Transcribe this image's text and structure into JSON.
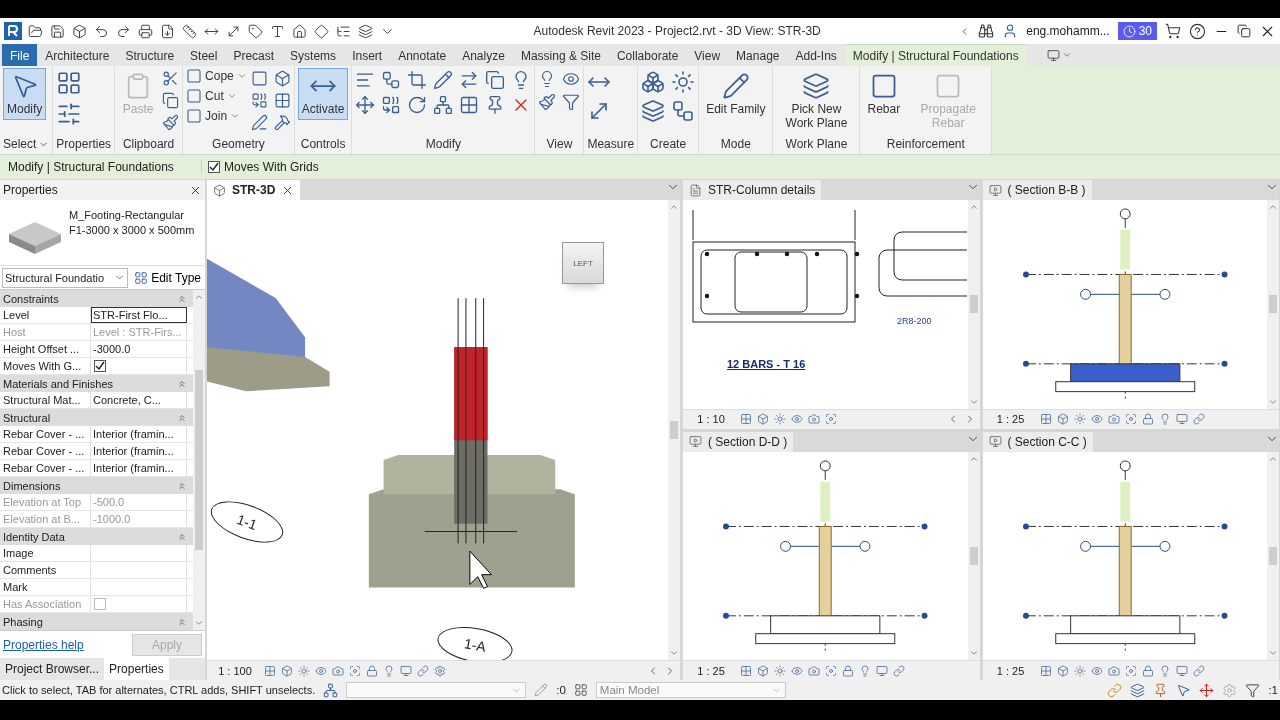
{
  "title_bar": {
    "title": "Autodesk Revit 2023 - Project2.rvt - 3D View: STR-3D",
    "user": "eng.mohamm...",
    "trial_days": "30"
  },
  "ribbon_tabs": [
    {
      "label": "File",
      "kind": "file",
      "selected": false
    },
    {
      "label": "Architecture",
      "kind": "tab",
      "selected": false
    },
    {
      "label": "Structure",
      "kind": "tab",
      "selected": false
    },
    {
      "label": "Steel",
      "kind": "tab",
      "selected": false
    },
    {
      "label": "Precast",
      "kind": "tab",
      "selected": false
    },
    {
      "label": "Systems",
      "kind": "tab",
      "selected": false
    },
    {
      "label": "Insert",
      "kind": "tab",
      "selected": false
    },
    {
      "label": "Annotate",
      "kind": "tab",
      "selected": false
    },
    {
      "label": "Analyze",
      "kind": "tab",
      "selected": false
    },
    {
      "label": "Massing & Site",
      "kind": "tab",
      "selected": false
    },
    {
      "label": "Collaborate",
      "kind": "tab",
      "selected": false
    },
    {
      "label": "View",
      "kind": "tab",
      "selected": false
    },
    {
      "label": "Manage",
      "kind": "tab",
      "selected": false
    },
    {
      "label": "Add-Ins",
      "kind": "tab",
      "selected": false
    },
    {
      "label": "Modify | Structural Foundations",
      "kind": "tab",
      "selected": true
    }
  ],
  "ribbon": {
    "panels": [
      {
        "label": "Select",
        "menu": true,
        "tools": [
          {
            "kind": "large",
            "label": "Modify",
            "selected": true,
            "disabled": false
          }
        ]
      },
      {
        "label": "Properties",
        "menu": false
      },
      {
        "label": "Clipboard",
        "menu": false,
        "tools": [
          {
            "kind": "large",
            "label": "Paste",
            "selected": false,
            "disabled": true
          }
        ]
      },
      {
        "label": "Geometry",
        "menu": false,
        "tools": [
          {
            "kind": "small",
            "label": "Cope",
            "menu": true
          },
          {
            "kind": "small",
            "label": "Cut",
            "menu": true
          },
          {
            "kind": "small",
            "label": "Join",
            "menu": true
          }
        ]
      },
      {
        "label": "Controls",
        "menu": false,
        "tools": [
          {
            "kind": "large",
            "label": "Activate",
            "selected": true,
            "disabled": false
          }
        ]
      },
      {
        "label": "Modify",
        "menu": false
      },
      {
        "label": "View",
        "menu": false
      },
      {
        "label": "Measure",
        "menu": false
      },
      {
        "label": "Create",
        "menu": false
      },
      {
        "label": "Mode",
        "menu": false,
        "tools": [
          {
            "kind": "large",
            "label": "Edit Family",
            "selected": false,
            "disabled": false
          }
        ]
      },
      {
        "label": "Work Plane",
        "menu": false,
        "tools": [
          {
            "kind": "large",
            "label": "Pick New Work Plane",
            "selected": false,
            "disabled": false
          }
        ]
      },
      {
        "label": "Reinforcement",
        "menu": false,
        "tools": [
          {
            "kind": "large",
            "label": "Rebar",
            "selected": false,
            "disabled": false
          },
          {
            "kind": "large",
            "label": "Propagate Rebar",
            "selected": false,
            "disabled": true
          }
        ]
      }
    ]
  },
  "options_bar": {
    "context": "Modify | Structural Foundations",
    "option": {
      "label": "Moves With Grids",
      "checked": true
    }
  },
  "properties": {
    "header": "Properties",
    "type_family": "M_Footing-Rectangular",
    "type_name": "F1-3000 x 3000 x 500mm",
    "category": "Structural Foundatio",
    "edit_type": "Edit Type",
    "groups": [
      {
        "name": "Constraints",
        "rows": [
          {
            "label": "Level",
            "value": "STR-First Flo...",
            "kind": "text",
            "disabled": false,
            "active": true
          },
          {
            "label": "Host",
            "value": "Level : STR-Firs...",
            "kind": "text",
            "disabled": true,
            "active": false
          },
          {
            "label": "Height Offset ...",
            "value": "-3000.0",
            "kind": "text",
            "disabled": false,
            "active": false
          },
          {
            "label": "Moves With G...",
            "kind": "checkbox",
            "checked": true,
            "disabled": false,
            "active": false
          }
        ]
      },
      {
        "name": "Materials and Finishes",
        "rows": [
          {
            "label": "Structural Mat...",
            "value": "Concrete, C...",
            "kind": "text",
            "disabled": false,
            "active": false
          }
        ]
      },
      {
        "name": "Structural",
        "rows": [
          {
            "label": "Rebar Cover - ...",
            "value": "Interior (framin...",
            "kind": "text",
            "disabled": false,
            "active": false
          },
          {
            "label": "Rebar Cover - ...",
            "value": "Interior (framin...",
            "kind": "text",
            "disabled": false,
            "active": false
          },
          {
            "label": "Rebar Cover - ...",
            "value": "Interior (framin...",
            "kind": "text",
            "disabled": false,
            "active": false
          }
        ]
      },
      {
        "name": "Dimensions",
        "rows": [
          {
            "label": "Elevation at Top",
            "value": "-500.0",
            "kind": "text",
            "disabled": true,
            "active": false
          },
          {
            "label": "Elevation at B...",
            "value": "-1000.0",
            "kind": "text",
            "disabled": true,
            "active": false
          }
        ]
      },
      {
        "name": "Identity Data",
        "rows": [
          {
            "label": "Image",
            "kind": "text",
            "disabled": false,
            "active": false
          },
          {
            "label": "Comments",
            "kind": "text",
            "disabled": false,
            "active": false
          },
          {
            "label": "Mark",
            "kind": "text",
            "disabled": false,
            "active": false
          },
          {
            "label": "Has Association",
            "kind": "checkbox",
            "checked": false,
            "disabled": true,
            "active": false
          }
        ]
      },
      {
        "name": "Phasing"
      }
    ],
    "help_link": "Properties help",
    "apply": "Apply",
    "apply_disabled": true
  },
  "browser_tabs": [
    {
      "label": "Project Browser...",
      "selected": false
    },
    {
      "label": "Properties",
      "selected": true
    }
  ],
  "views": [
    {
      "kind": "model",
      "title": "STR-3D",
      "active": true,
      "closable": true,
      "scale": "1 : 100",
      "grid_bubbles": [
        "1-1",
        "1-A"
      ],
      "view_cube": "LEFT"
    },
    {
      "kind": "detail",
      "title": "STR-Column details",
      "active": false,
      "closable": false,
      "scale": "1 : 10",
      "notes": [
        "2R8-200",
        "12 BARS - T 16"
      ]
    },
    {
      "kind": "section",
      "title": "( Section B-B )",
      "active": false,
      "closable": false,
      "scale": "1 : 25",
      "footing_selected": true
    },
    {
      "kind": "section",
      "title": "( Section D-D )",
      "active": false,
      "closable": false,
      "scale": "1 : 25",
      "footing_selected": false
    },
    {
      "kind": "section",
      "title": "( Section C-C )",
      "active": false,
      "closable": false,
      "scale": "1 : 25",
      "footing_selected": false
    }
  ],
  "status_bar": {
    "message": "Click to select, TAB for alternates, CTRL adds, SHIFT unselects.",
    "selection_count": ":0",
    "model": "Main Model",
    "filter_count": ":1"
  }
}
